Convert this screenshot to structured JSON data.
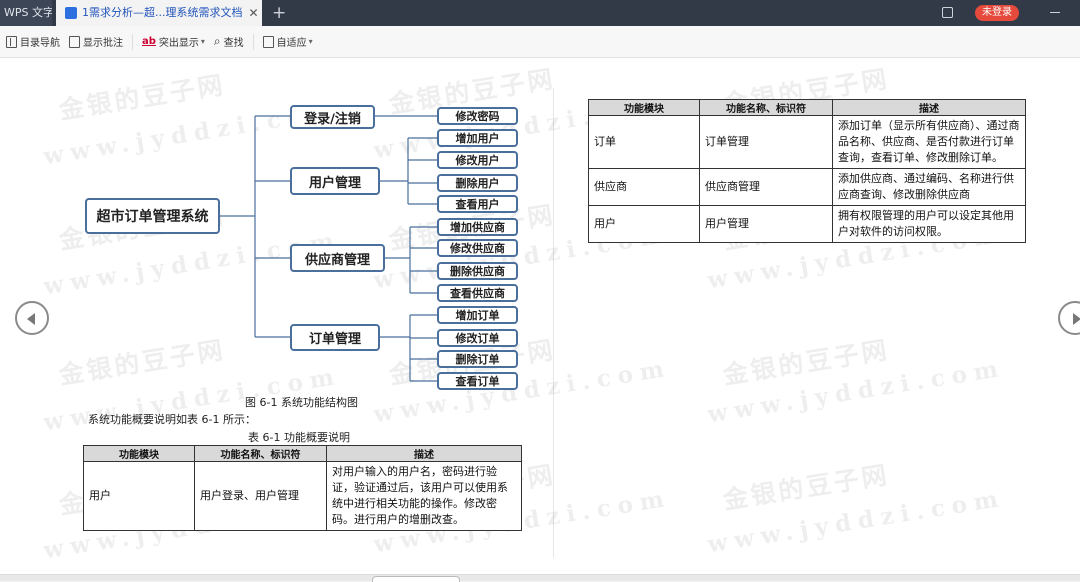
{
  "titlebar": {
    "app_tab": "WPS 文字",
    "doc_tab": "1需求分析—超...理系统需求文档",
    "close_glyph": "✕",
    "new_tab_glyph": "+",
    "login_badge": "未登录"
  },
  "toolbar": {
    "items": [
      {
        "label": "目录导航",
        "icon": "nav-pane-icon"
      },
      {
        "label": "显示批注",
        "icon": "comment-icon"
      },
      {
        "label": "突出显示",
        "icon": "highlight-icon",
        "dropdown": true
      },
      {
        "label": "查找",
        "icon": "search-icon"
      },
      {
        "label": "自适应",
        "icon": "fit-page-icon",
        "dropdown": true
      }
    ]
  },
  "watermark": {
    "cn": "金银的豆子网",
    "en": "www.jyddzi.com"
  },
  "diagram": {
    "root": "超市订单管理系统",
    "groups": [
      {
        "label": "登录/注销",
        "children": [
          "修改密码"
        ]
      },
      {
        "label": "用户管理",
        "children": [
          "增加用户",
          "修改用户",
          "删除用户",
          "查看用户"
        ]
      },
      {
        "label": "供应商管理",
        "children": [
          "增加供应商",
          "修改供应商",
          "删除供应商",
          "查看供应商"
        ]
      },
      {
        "label": "订单管理",
        "children": [
          "增加订单",
          "修改订单",
          "删除订单",
          "查看订单"
        ]
      }
    ],
    "caption": "图 6-1  系统功能结构图"
  },
  "left_page": {
    "intro": "系统功能概要说明如表 6-1 所示：",
    "table_caption": "表 6-1  功能概要说明",
    "table": {
      "headers": [
        "功能模块",
        "功能名称、标识符",
        "描述"
      ],
      "rows": [
        [
          "用户",
          "用户登录、用户管理",
          "对用户输入的用户名，密码进行验证，验证通过后，该用户可以使用系统中进行相关功能的操作。修改密码。进行用户的增删改查。"
        ]
      ]
    }
  },
  "right_page": {
    "table": {
      "headers": [
        "功能模块",
        "功能名称、标识符",
        "描述"
      ],
      "rows": [
        [
          "订单",
          "订单管理",
          "添加订单（显示所有供应商）、通过商品名称、供应商、是否付款进行订单查询，查看订单、修改删除订单。"
        ],
        [
          "供应商",
          "供应商管理",
          "添加供应商、通过编码、名称进行供应商查询、修改删除供应商"
        ],
        [
          "用户",
          "用户管理",
          "拥有权限管理的用户可以设定其他用户对软件的访问权限。"
        ]
      ]
    }
  }
}
